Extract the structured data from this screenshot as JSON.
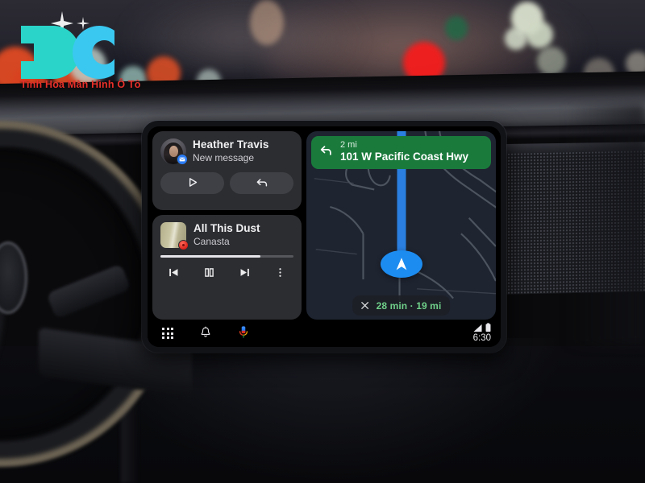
{
  "watermark": {
    "logo_letters": "DC",
    "tagline": "Tinh Hoa Màn Hình Ô Tô",
    "logo_color": "#2ad4c8",
    "logo_color_alt": "#3ac8f0",
    "tagline_color": "#e8302a"
  },
  "headunit": {
    "message_card": {
      "sender": "Heather Travis",
      "status": "New message",
      "avatar_name": "contact-photo",
      "badge_icon": "message-app-badge-icon",
      "actions": [
        {
          "name": "play-message-button",
          "icon": "play-icon"
        },
        {
          "name": "reply-message-button",
          "icon": "reply-arrow-icon"
        }
      ]
    },
    "media_card": {
      "title": "All This Dust",
      "artist": "Canasta",
      "progress_percent": 75,
      "album_art_name": "album-art",
      "app_badge_icon": "media-app-badge-icon",
      "controls": [
        {
          "name": "previous-track-button",
          "icon": "skip-previous-icon"
        },
        {
          "name": "pause-button",
          "icon": "pause-icon"
        },
        {
          "name": "next-track-button",
          "icon": "skip-next-icon"
        },
        {
          "name": "media-overflow-button",
          "icon": "more-vertical-icon"
        }
      ]
    },
    "navigation": {
      "maneuver_icon": "turn-left-arrow-icon",
      "distance": "2 mi",
      "road": "101 W Pacific Coast Hwy",
      "banner_color": "#1a7a3c",
      "eta": "28 min · 19 mi",
      "eta_color": "#6fcf89",
      "close_icon": "close-x-icon",
      "route_color": "#2a7fe0",
      "map_background": "#1e2430",
      "position_marker": "navigation-position-puck"
    },
    "bottom_bar": {
      "apps_icon": "app-grid-icon",
      "notifications_icon": "bell-icon",
      "assistant_icon": "microphone-icon",
      "signal_icon": "cellular-signal-icon",
      "battery_icon": "battery-icon",
      "time": "6:30"
    }
  }
}
